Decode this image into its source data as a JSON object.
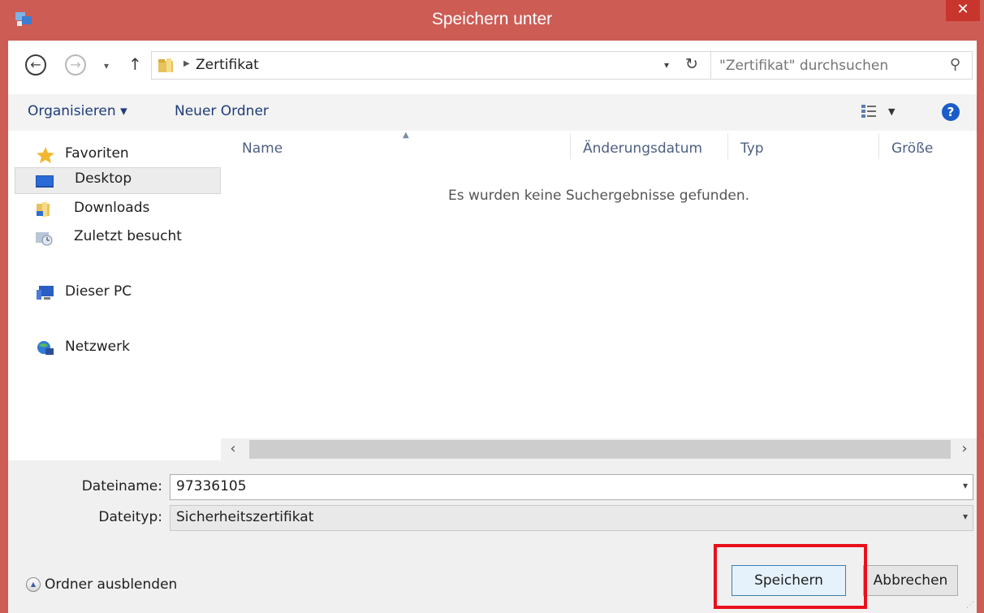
{
  "window": {
    "title": "Speichern unter",
    "close_label": "✕"
  },
  "address": {
    "breadcrumb": "Zertifikat",
    "search_placeholder": "\"Zertifikat\" durchsuchen"
  },
  "toolbar": {
    "organize_label": "Organisieren ▾",
    "new_folder_label": "Neuer Ordner",
    "help_label": "?"
  },
  "sidebar": {
    "items": [
      {
        "label": "Favoriten",
        "icon": "star-icon"
      },
      {
        "label": "Desktop",
        "icon": "desktop-icon",
        "selected": true
      },
      {
        "label": "Downloads",
        "icon": "downloads-folder-icon"
      },
      {
        "label": "Zuletzt besucht",
        "icon": "recent-places-icon"
      },
      {
        "label": "Dieser PC",
        "icon": "computer-icon"
      },
      {
        "label": "Netzwerk",
        "icon": "network-icon"
      }
    ]
  },
  "filelist": {
    "columns": [
      "Name",
      "Änderungsdatum",
      "Typ",
      "Größe"
    ],
    "empty_message": "Es wurden keine Suchergebnisse gefunden."
  },
  "fields": {
    "filename_label": "Dateiname:",
    "filename_value": "97336105",
    "filetype_label": "Dateityp:",
    "filetype_value": "Sicherheitszertifikat"
  },
  "footer": {
    "hide_folders_label": "Ordner ausblenden",
    "save_label": "Speichern",
    "cancel_label": "Abbrechen"
  },
  "colors": {
    "window_frame": "#cd5c55",
    "close_button": "#c7352d",
    "highlight_box": "#e8101c",
    "link_text": "#1e3c78"
  }
}
